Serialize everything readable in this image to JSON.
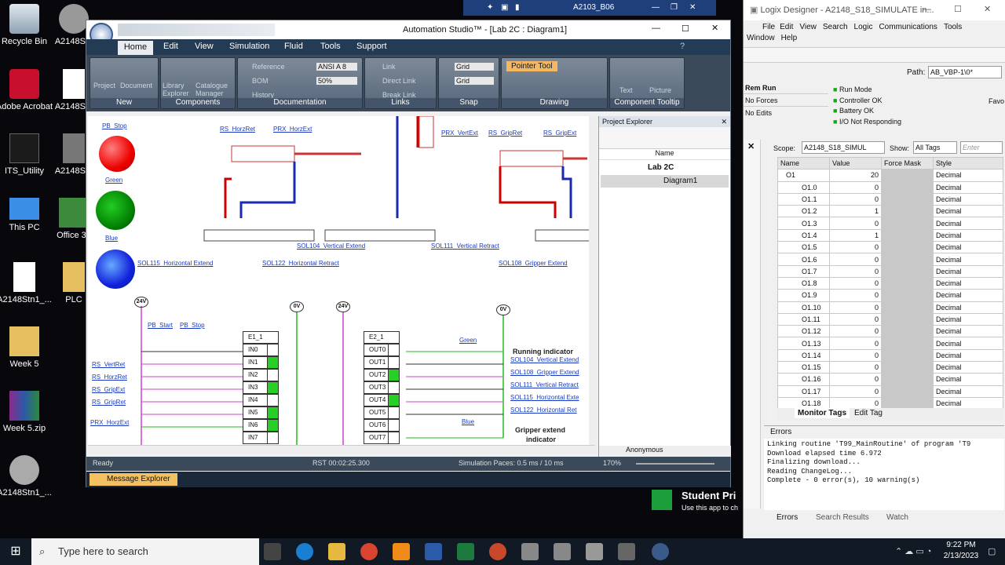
{
  "desktop": {
    "icons": [
      "Recycle Bin",
      "A2148Stn",
      "Adobe Acrobat",
      "A2148Stn",
      "ITS_Utility",
      "A2148Stn",
      "This PC",
      "Office 36",
      "A2148Stn1_...",
      "PLC",
      "Week 5",
      "Week 5.zip",
      "A2148Stn1_..."
    ]
  },
  "vm_bar": {
    "title": "A2103_B06"
  },
  "automation_studio": {
    "title": "Automation Studio™ - [Lab 2C : Diagram1]",
    "tabs": [
      "Home",
      "Edit",
      "View",
      "Simulation",
      "Fluid",
      "Tools",
      "Support"
    ],
    "groups": [
      "New",
      "Components",
      "Documentation",
      "Links",
      "Snap",
      "Drawing",
      "Component Tooltip"
    ],
    "buttons": {
      "project": "Project",
      "document": "Document",
      "library": "Library Explorer",
      "catalogue": "Catalogue Manager",
      "reference": "Reference",
      "bom": "BOM",
      "history": "History",
      "ansi": "ANSI A  8",
      "zoom": "50%",
      "link": "Link",
      "direct_link": "Direct Link",
      "break_link": "Break Link",
      "grid1": "Grid",
      "grid2": "Grid",
      "pointer": "Pointer Tool",
      "text": "Text",
      "picture": "Picture"
    },
    "diagram": {
      "pb_stop": "PB_Stop",
      "green": "Green",
      "blue": "Blue",
      "rs_horzret": "RS_HorzRet",
      "prx_horzext": "PRX_HorzExt",
      "prx_vertext": "PRX_VertExt",
      "rs_gripret": "RS_GripRet",
      "rs_gripext": "RS_GripExt",
      "sol115": "SOL115_Horizontal Extend",
      "sol122": "SOL122_Horizontal Retract",
      "sol104": "SOL104_Vertical Extend",
      "sol111": "SOL111_Vertical Retract",
      "sol108": "SOL108_Gripper Extend",
      "v24a": "24V",
      "v0a": "0V",
      "v24b": "24V",
      "v0b": "0V",
      "pb_start": "PB_Start",
      "pb_stop2": "PB_Stop",
      "left_labels": [
        "RS_VertRet",
        "RS_HorzRet",
        "RS_GripExt",
        "RS_GripRet",
        "PRX_HorzExt"
      ],
      "e1": {
        "title": "E1_1",
        "inputs": [
          "IN0",
          "IN1",
          "IN2",
          "IN3",
          "IN4",
          "IN5",
          "IN6",
          "IN7"
        ],
        "active": [
          false,
          true,
          false,
          true,
          false,
          true,
          true,
          false
        ]
      },
      "e2": {
        "title": "E2_1",
        "outputs": [
          "OUT0",
          "OUT1",
          "OUT2",
          "OUT3",
          "OUT4",
          "OUT5",
          "OUT6",
          "OUT7"
        ],
        "active": [
          false,
          false,
          true,
          false,
          true,
          false,
          false,
          false
        ]
      },
      "green2": "Green",
      "blue2": "Blue",
      "running": "Running indicator",
      "gripper_ind1": "Gripper extend",
      "gripper_ind2": "indicator",
      "right_labels": [
        "SOL104_Vertical Extend",
        "SOL108_Gripper Extend",
        "SOL111_Vertical Retract",
        "SOL115_Horizontal Exte",
        "SOL122_Horizontal Ret"
      ]
    },
    "project_explorer": {
      "title": "Project Explorer",
      "col": "Name",
      "project": "Lab 2C",
      "diagram": "Diagram1",
      "footer": "Anonymous"
    },
    "status": {
      "ready": "Ready",
      "rst": "RST 00:02:25.300",
      "pace": "Simulation Paces: 0.5 ms / 10 ms",
      "zoom": "170%"
    },
    "message_explorer": "Message Explorer"
  },
  "logix": {
    "title": "Logix Designer - A2148_S18_SIMULATE in...",
    "menu": [
      "File",
      "Edit",
      "View",
      "Search",
      "Logic",
      "Communications",
      "Tools",
      "Window",
      "Help"
    ],
    "path_label": "Path:",
    "path": "AB_VBP-1\\0*",
    "status_left": [
      "Rem Run",
      "No Forces",
      "No Edits"
    ],
    "status_right": [
      "Run Mode",
      "Controller OK",
      "Battery OK",
      "I/O Not Responding"
    ],
    "scope_label": "Scope:",
    "scope": "A2148_S18_SIMUL",
    "show_label": "Show:",
    "show": "All Tags",
    "filter": "Enter",
    "columns": [
      "Name",
      "Value",
      "Force Mask",
      "Style"
    ],
    "rows": [
      {
        "n": "O1",
        "v": "20",
        "s": "Decimal"
      },
      {
        "n": "O1.0",
        "v": "0",
        "s": "Decimal"
      },
      {
        "n": "O1.1",
        "v": "0",
        "s": "Decimal"
      },
      {
        "n": "O1.2",
        "v": "1",
        "s": "Decimal"
      },
      {
        "n": "O1.3",
        "v": "0",
        "s": "Decimal"
      },
      {
        "n": "O1.4",
        "v": "1",
        "s": "Decimal"
      },
      {
        "n": "O1.5",
        "v": "0",
        "s": "Decimal"
      },
      {
        "n": "O1.6",
        "v": "0",
        "s": "Decimal"
      },
      {
        "n": "O1.7",
        "v": "0",
        "s": "Decimal"
      },
      {
        "n": "O1.8",
        "v": "0",
        "s": "Decimal"
      },
      {
        "n": "O1.9",
        "v": "0",
        "s": "Decimal"
      },
      {
        "n": "O1.10",
        "v": "0",
        "s": "Decimal"
      },
      {
        "n": "O1.11",
        "v": "0",
        "s": "Decimal"
      },
      {
        "n": "O1.12",
        "v": "0",
        "s": "Decimal"
      },
      {
        "n": "O1.13",
        "v": "0",
        "s": "Decimal"
      },
      {
        "n": "O1.14",
        "v": "0",
        "s": "Decimal"
      },
      {
        "n": "O1.15",
        "v": "0",
        "s": "Decimal"
      },
      {
        "n": "O1.16",
        "v": "0",
        "s": "Decimal"
      },
      {
        "n": "O1.17",
        "v": "0",
        "s": "Decimal"
      },
      {
        "n": "O1.18",
        "v": "0",
        "s": "Decimal"
      }
    ],
    "tag_tabs": [
      "Monitor Tags",
      "Edit Tag"
    ],
    "errors_title": "Errors",
    "log": [
      "Linking routine 'T99_MainRoutine' of program 'T9",
      "Download elapsed time 6.972",
      "Finalizing download...",
      "Reading ChangeLog...",
      "Complete - 0 error(s), 10 warning(s)"
    ],
    "bottom_tabs": [
      "Errors",
      "Search Results",
      "Watch"
    ],
    "right_prefix": "Favo"
  },
  "notification": {
    "title": "Student Pri",
    "sub": "Use this app to ch"
  },
  "taskbar": {
    "search": "Type here to search",
    "time": "9:22 PM",
    "date": "2/13/2023"
  }
}
